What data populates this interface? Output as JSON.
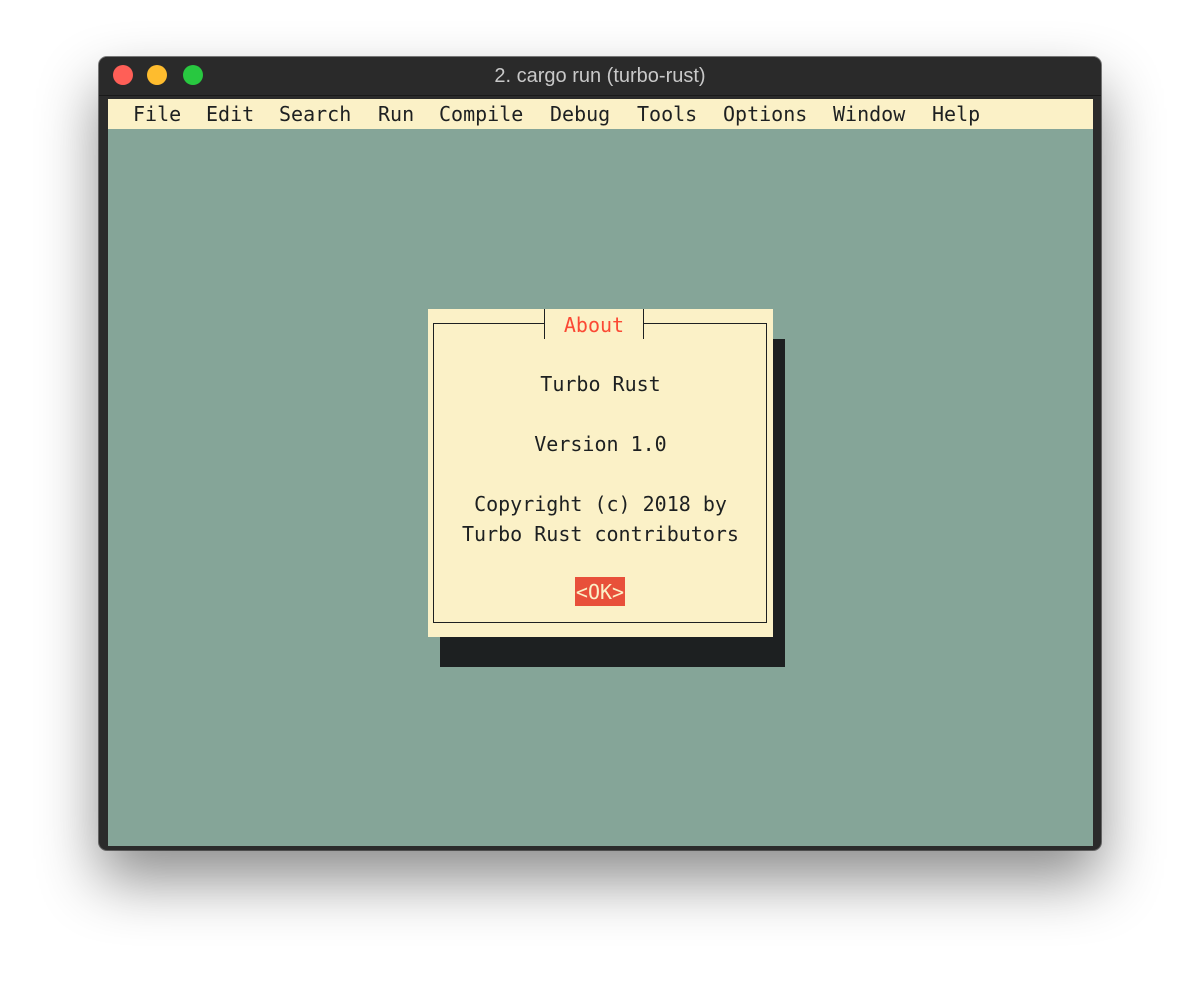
{
  "window": {
    "title": "2. cargo run (turbo-rust)"
  },
  "menubar": {
    "items": [
      {
        "label": "File"
      },
      {
        "label": "Edit"
      },
      {
        "label": "Search"
      },
      {
        "label": "Run"
      },
      {
        "label": "Compile"
      },
      {
        "label": "Debug"
      },
      {
        "label": "Tools"
      },
      {
        "label": "Options"
      },
      {
        "label": "Window"
      },
      {
        "label": "Help"
      }
    ]
  },
  "dialog": {
    "title": "About",
    "app_name": "Turbo Rust",
    "version": "Version 1.0",
    "copyright_line1": "Copyright (c) 2018 by",
    "copyright_line2": "Turbo Rust contributors",
    "ok_label": "<OK>"
  },
  "colors": {
    "desktop": "#85a598",
    "menubar_bg": "#fbf1c7",
    "dialog_bg": "#fbf1c7",
    "dialog_title": "#fb4934",
    "ok_button_bg": "#e8503a",
    "shadow": "#1d2021"
  }
}
